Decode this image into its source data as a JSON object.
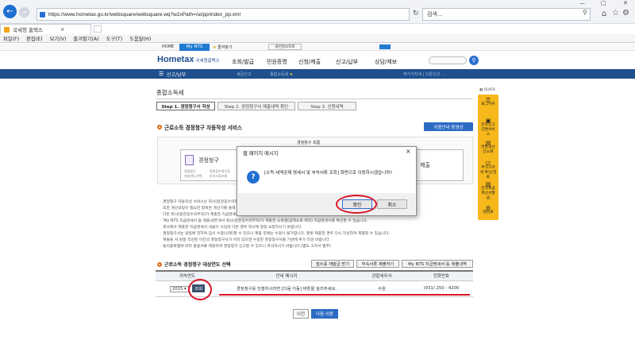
{
  "browser": {
    "url": "https://www.hometax.go.kr/websquare/websquare.wq?w2xPath=/ui/pp/index_pp.xml",
    "search_placeholder": "검색...",
    "tab_title": "국세청 홈택스",
    "menu": [
      "파일(F)",
      "편집(E)",
      "보기(V)",
      "즐겨찾기(A)",
      "도구(T)",
      "도움말(H)"
    ]
  },
  "site": {
    "home_label": "HOME",
    "mynts_label": "My NTS",
    "favorites_label": "즐겨찾기",
    "zoom_label": "화면크기",
    "print_label": "화면정보조회",
    "logo_text": "Hometax",
    "logo_sub": "국세청홈택스",
    "nav": [
      "조회/발급",
      "민원증명",
      "신청/제출",
      "신고/납부",
      "상담/제보"
    ],
    "breadcrumb": [
      "신고/납부",
      "세금신고",
      "종합소득세"
    ],
    "right_breadcrumb": "부가가치세 | 다른신고 ..."
  },
  "page": {
    "title": "종합소득세",
    "steps": [
      "Step 1. 경정청구서 작성",
      "Step 2. 경정청구서 제출내역 확인",
      "Step 3. 신청내역"
    ],
    "section1_title": "근로소득 경정청구 자동작성 서비스",
    "guide_button": "이용안내 동영상",
    "flow_title": "경정청구 흐름",
    "flow_box1": "경정청구",
    "flow_box1_sub": [
      "경정청구",
      "대상연도선택"
    ],
    "flow_box1_sub2": [
      "원천징수영수증",
      "부속서류조회"
    ],
    "flow_box3": "제출",
    "bullets": [
      "경정청구 자동작성 서비스는 회사(원천징수의무자)가 제출한 근로소득 지급명세서 등을 기초로 하여 경정청구서를 작성합니다.",
      "또한 계산과정이 필요한 항목은 계산기를 통해 쉽게 적용할 수 있습니다.",
      "다만 회사(원천징수의무자)가 제출한 지급명세서 내용에 오류가 있는 경우에는 경정청구가 불가능하오니 회사에 문의하시기 바랍니다.",
      "'My NTS 지급명세서 등 제출내역'에서 회사(원천징수의무자)가 제출한 소득별(공제소득 제외) 지급명세서를 확인할 수 있습니다.",
      "회사에서 제출한 지급명세서 내용이 사실과 다른 경우 회사에 정정 요청하시기 바랍니다.",
      "경정청구서는 당일에 한하여 임시 수정(삭제)할 수 있으나 제출 후에는 수정이 불가합니다. 잘못 제출한 경우 다시 작성하여 제출할 수 있습니다.",
      "제출을 서 당일 작성된 이전의 경정청구서가 이미 있으면 수정한 경정청구서를 기반에 추가 작성 비랍니다.",
      "동의종목별에 따라 증빙서류 제출하여 경정청구 신고할 수 있으니 유의하시기 바랍니다.(별도 고지서 발부)"
    ],
    "section2_title": "근로소득 경정청구 대상연도 선택",
    "section2_buttons": [
      "접수증 재발급 받기",
      "부속서류 제출하기",
      "My NTS 지급명세서 등 제출내역"
    ],
    "table_headers": [
      "귀속연도",
      "안내 메시지",
      "관할세무서",
      "전화번호"
    ],
    "table_row": {
      "year": "2015",
      "lookup": "조회",
      "message": "경정청구를 진행하시려면 [다음 이동] 버튼을 눌러주세요.",
      "office": "수원",
      "phone": "(031) 250 - 4200"
    },
    "prev_button": "이전",
    "next_button": "다음 이동"
  },
  "quick": {
    "title": "QUICK",
    "items": [
      "로그아웃",
      "전자신고 간편서비스",
      "연말정산 간소화",
      "부가가치세 확인/검토",
      "전자세금 계산서발급",
      "맨위로"
    ]
  },
  "dialog": {
    "title": "웹 페이지 메시지",
    "message": "[소득·세액공제 명세서 및 부속서류 조회] 화면으로 이동하시겠습니까?",
    "ok": "확인",
    "cancel": "취소"
  },
  "colors": {
    "brand_blue": "#1f4f8d",
    "accent_orange": "#f6b81b",
    "highlight_red": "#d8152b"
  }
}
